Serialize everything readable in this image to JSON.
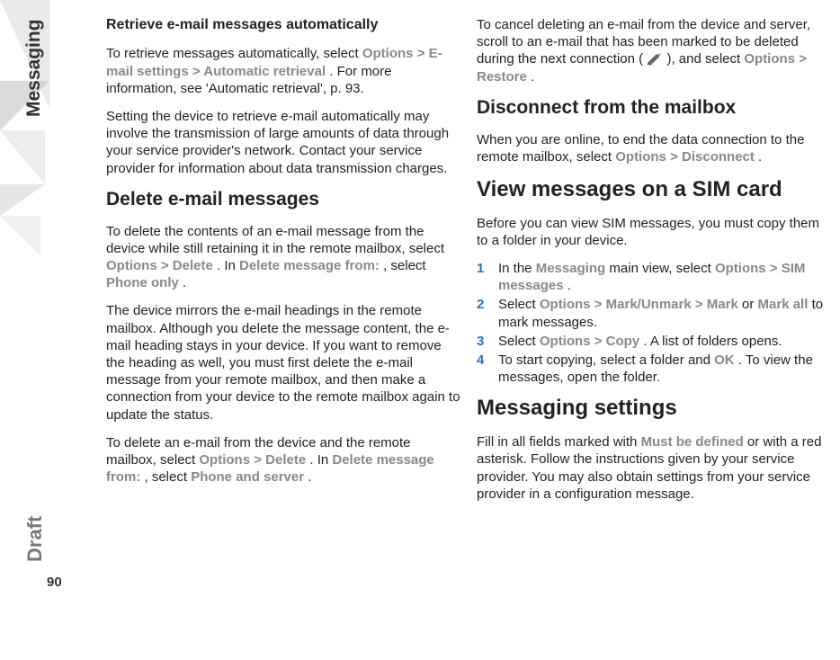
{
  "side": {
    "messaging": "Messaging",
    "draft": "Draft",
    "page": "90"
  },
  "col1": {
    "h_retrieve": "Retrieve e-mail messages automatically",
    "p1a": "To retrieve messages automatically, select ",
    "opt": "Options",
    "gt": ">",
    "email_settings": "E-mail settings",
    "auto_retrieval": "Automatic retrieval",
    "p1b": ". For more information, see 'Automatic retrieval', p. 93.",
    "p2": "Setting the device to retrieve e-mail automatically may involve the transmission of large amounts of data through your service provider's network. Contact your service provider for information about data transmission charges.",
    "h_delete": "Delete e-mail messages",
    "p3a": "To delete the contents of an e-mail message from the device while still retaining it in the remote mailbox, select ",
    "delete": "Delete",
    "p3b": ". In ",
    "del_from": "Delete message from:",
    "p3c": ", select ",
    "phone_only": "Phone only",
    "p3d": ".",
    "p4": "The device mirrors the e-mail headings in the remote mailbox. Although you delete the message content, the e-mail heading stays in your device. If you want to remove the heading as well, you must first delete the e-mail message from your remote mailbox, and then make a connection from your device to the remote mailbox again to update the status.",
    "p5a": "To delete an e-mail from the device and the remote mailbox, select ",
    "p5b": ". In ",
    "p5c": ", select ",
    "phone_server": "Phone and server",
    "p5d": "."
  },
  "col2": {
    "p1a": "To cancel deleting an e-mail from the device and server, scroll to an e-mail that has been marked to be deleted during the next connection (",
    "p1b": "), and select ",
    "restore": "Restore",
    "p1c": ".",
    "h_disconnect": "Disconnect from the mailbox",
    "p2a": "When you are online, to end the data connection to the remote mailbox, select ",
    "disconnect": "Disconnect",
    "p2b": ".",
    "h_sim": "View messages on a SIM card",
    "p3": "Before you can view SIM messages, you must copy them to a folder in your device.",
    "li1a": "In the ",
    "messaging": "Messaging",
    "li1b": " main view, select ",
    "sim_msgs": "SIM messages",
    "li1c": ".",
    "li2a": "Select ",
    "mark_unmark": "Mark/Unmark",
    "mark": "Mark",
    "or": " or ",
    "mark_all": "Mark all",
    "li2b": " to mark messages.",
    "li3a": "Select ",
    "copy": "Copy",
    "li3b": ". A list of folders opens.",
    "li4a": "To start copying, select a folder and ",
    "ok": "OK",
    "li4b": ". To view the messages, open the folder.",
    "h_settings": "Messaging settings",
    "p4a": "Fill in all fields marked with ",
    "must": "Must be defined",
    "p4b": " or with a red asterisk. Follow the instructions given by your service provider. You may also obtain settings from your service provider in a configuration message.",
    "n1": "1",
    "n2": "2",
    "n3": "3",
    "n4": "4"
  }
}
